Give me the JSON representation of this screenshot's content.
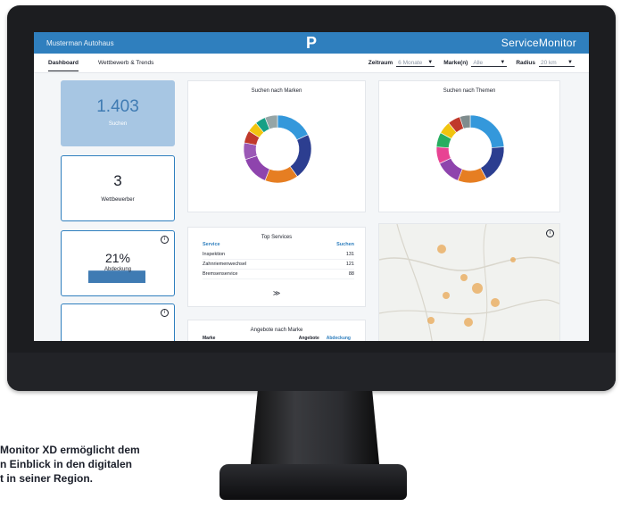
{
  "app": {
    "title_left": "Musterman Autohaus",
    "logo": "P",
    "product": "ServiceMonitor"
  },
  "tabs": [
    {
      "label": "Dashboard"
    },
    {
      "label": "Wettbewerb & Trends"
    }
  ],
  "filters": {
    "zeitraum": {
      "label": "Zeitraum",
      "value": "6 Monate"
    },
    "marke": {
      "label": "Marke(n)",
      "value": "Alle"
    },
    "radius": {
      "label": "Radius",
      "value": "20 km"
    }
  },
  "kpis": {
    "searches": {
      "value": "1.403",
      "caption": "Suchen"
    },
    "competitors": {
      "value": "3",
      "caption": "Wettbewerber"
    },
    "conversion": {
      "value": "21%",
      "caption": "Abdeckung",
      "fill": 0.21
    }
  },
  "cards": {
    "brands_title": "Suchen nach Marken",
    "topics_title": "Suchen nach Themen"
  },
  "pie_brands": [
    {
      "color": "#3498db",
      "value": 18
    },
    {
      "color": "#2c3e90",
      "value": 22
    },
    {
      "color": "#e67e22",
      "value": 16
    },
    {
      "color": "#8e44ad",
      "value": 14
    },
    {
      "color": "#9b59b6",
      "value": 8
    },
    {
      "color": "#c0392b",
      "value": 6
    },
    {
      "color": "#f1c40f",
      "value": 5
    },
    {
      "color": "#16a085",
      "value": 5
    },
    {
      "color": "#95a5a6",
      "value": 6
    }
  ],
  "pie_topics": [
    {
      "color": "#3498db",
      "value": 24
    },
    {
      "color": "#2c3e90",
      "value": 18
    },
    {
      "color": "#e67e22",
      "value": 14
    },
    {
      "color": "#8e44ad",
      "value": 12
    },
    {
      "color": "#e84393",
      "value": 8
    },
    {
      "color": "#27ae60",
      "value": 7
    },
    {
      "color": "#f1c40f",
      "value": 6
    },
    {
      "color": "#c0392b",
      "value": 6
    },
    {
      "color": "#7f8c8d",
      "value": 5
    }
  ],
  "top_services": {
    "title": "Top Services",
    "headers": [
      "Service",
      "Suchen"
    ],
    "rows": [
      {
        "name": "Inspektion",
        "value": "131"
      },
      {
        "name": "Zahnriemenwechsel",
        "value": "121"
      },
      {
        "name": "Bremsenservice",
        "value": "88"
      }
    ],
    "more": "≫"
  },
  "offers": {
    "title": "Angebote nach Marke",
    "headers": [
      "Marke",
      "Angebote",
      "Abdeckung"
    ]
  },
  "caption": {
    "line1": "Monitor XD ermöglicht dem",
    "line2": "n Einblick in den digitalen",
    "line3": "t in seiner Region."
  },
  "colors": {
    "brand": "#2f7fbe",
    "kpi_fill": "#a7c6e3"
  }
}
